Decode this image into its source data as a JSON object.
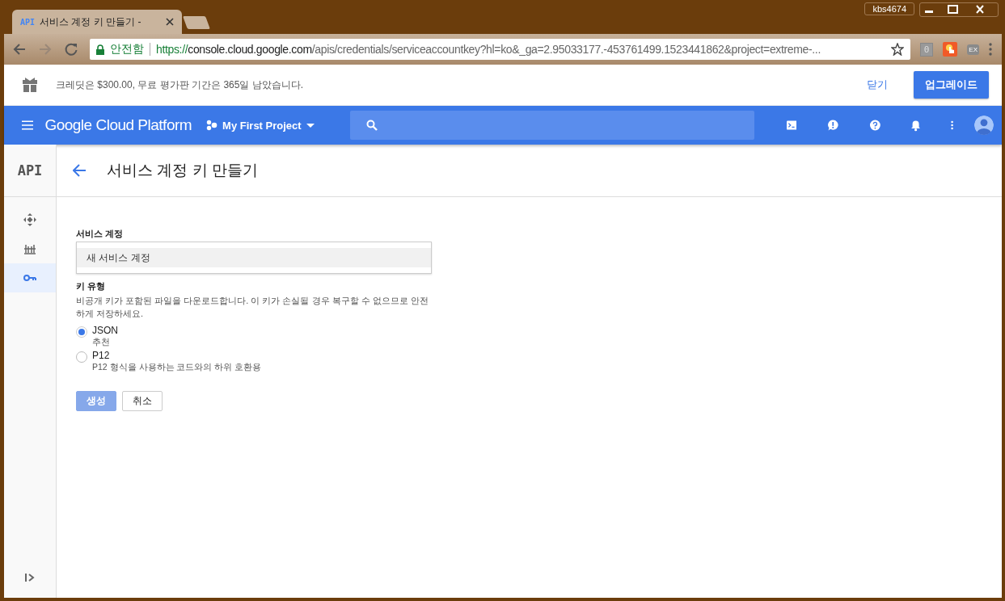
{
  "browser": {
    "tab": {
      "favicon": "API",
      "title": "서비스 계정 키 만들기 -",
      "selected": true
    },
    "profile": "kbs4674",
    "secure_label": "안전함",
    "url": {
      "scheme": "https://",
      "host": "console.cloud.google.com",
      "path": "/apis/credentials/serviceaccountkey?hl=ko&_ga=2.95033177.-453761499.1523441862&project=extreme-..."
    },
    "bookmarked": false,
    "extensions": [
      {
        "kind": "counter",
        "label": "0"
      },
      {
        "kind": "hand"
      },
      {
        "kind": "badge",
        "label": "EX"
      }
    ]
  },
  "promo": {
    "text": "크레딧은 $300.00, 무료 평가판 기간은 365일 남았습니다.",
    "dismiss": "닫기",
    "upgrade": "업그레이드"
  },
  "header": {
    "brand": "Google Cloud Platform",
    "project": "My First Project"
  },
  "sidebar": {
    "logo": "API",
    "items": [
      {
        "selected": false
      },
      {
        "selected": false
      },
      {
        "selected": true
      }
    ]
  },
  "page": {
    "title": "서비스 계정 키 만들기"
  },
  "form": {
    "account_label": "서비스 계정",
    "account_option": "새 서비스 계정",
    "key_type_label": "키 유형",
    "key_type_help": "비공개 키가 포함된 파일을 다운로드합니다. 이 키가 손실될 경우 복구할 수 없으므로 안전하게 저장하세요.",
    "options": [
      {
        "label": "JSON",
        "hint": "추천",
        "selected": true
      },
      {
        "label": "P12",
        "hint": "P12 형식을 사용하는 코드와의 하위 호환용",
        "selected": false
      }
    ],
    "buttons": [
      {
        "label": "생성",
        "kind": "primary",
        "disabled": true
      },
      {
        "label": "취소",
        "kind": "secondary",
        "disabled": false
      }
    ]
  }
}
